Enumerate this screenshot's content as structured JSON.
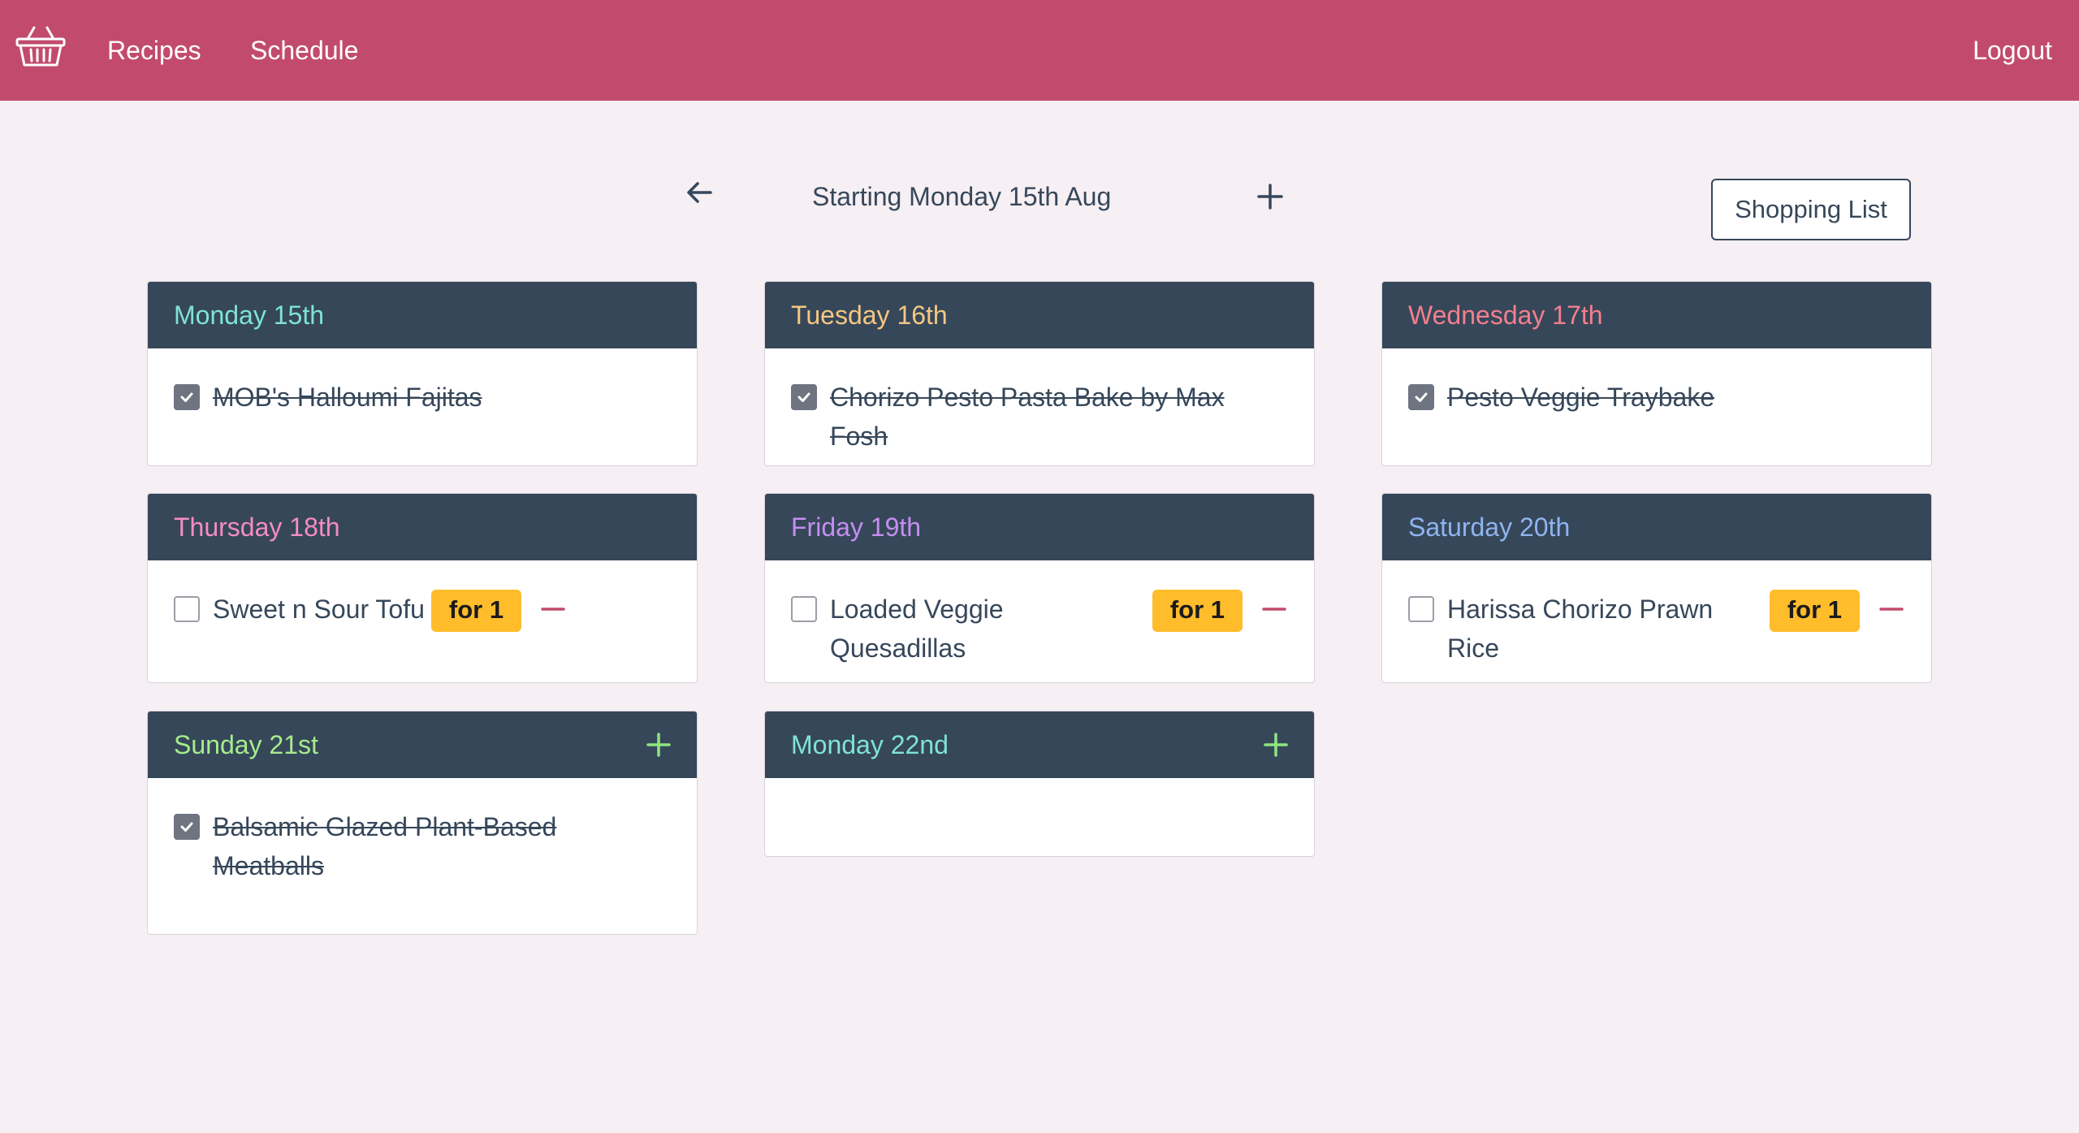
{
  "nav": {
    "brand_icon": "basket-icon",
    "recipes": "Recipes",
    "schedule": "Schedule",
    "logout": "Logout"
  },
  "week": {
    "title": "Starting Monday 15th Aug",
    "prev_icon": "arrow-left-icon",
    "add_icon": "plus-icon"
  },
  "shopping_list": "Shopping List",
  "colors": {
    "navbar": "#c24b6d",
    "card_header": "#36475a",
    "background": "#f6eff3",
    "badge": "#ffbc2b",
    "remove": "#c24b6d",
    "add": "#8ee57e"
  },
  "days": [
    {
      "name": "Monday 15th",
      "color": "#7fe3d8",
      "has_add": false,
      "meals": [
        {
          "name": "MOB's Halloumi Fajitas",
          "done": true
        }
      ]
    },
    {
      "name": "Tuesday 16th",
      "color": "#f5c781",
      "has_add": false,
      "meals": [
        {
          "name": "Chorizo Pesto Pasta Bake by Max Fosh",
          "done": true
        }
      ]
    },
    {
      "name": "Wednesday 17th",
      "color": "#f37f8c",
      "has_add": false,
      "meals": [
        {
          "name": "Pesto Veggie Traybake",
          "done": true
        }
      ]
    },
    {
      "name": "Thursday 18th",
      "color": "#f58cc2",
      "has_add": false,
      "meals": [
        {
          "name": "Sweet n Sour Tofu",
          "done": false,
          "badge": "for 1"
        }
      ]
    },
    {
      "name": "Friday 19th",
      "color": "#c58ef0",
      "has_add": false,
      "meals": [
        {
          "name": "Loaded Veggie Quesadillas",
          "done": false,
          "badge": "for 1"
        }
      ]
    },
    {
      "name": "Saturday 20th",
      "color": "#8fb4ee",
      "has_add": false,
      "meals": [
        {
          "name": "Harissa Chorizo Prawn Rice",
          "done": false,
          "badge": "for 1"
        }
      ]
    },
    {
      "name": "Sunday 21st",
      "color": "#a6ec8c",
      "has_add": true,
      "meals": [
        {
          "name": "Balsamic Glazed Plant-Based Meatballs",
          "done": true
        }
      ]
    },
    {
      "name": "Monday 22nd",
      "color": "#7fe3d8",
      "has_add": true,
      "meals": []
    }
  ]
}
